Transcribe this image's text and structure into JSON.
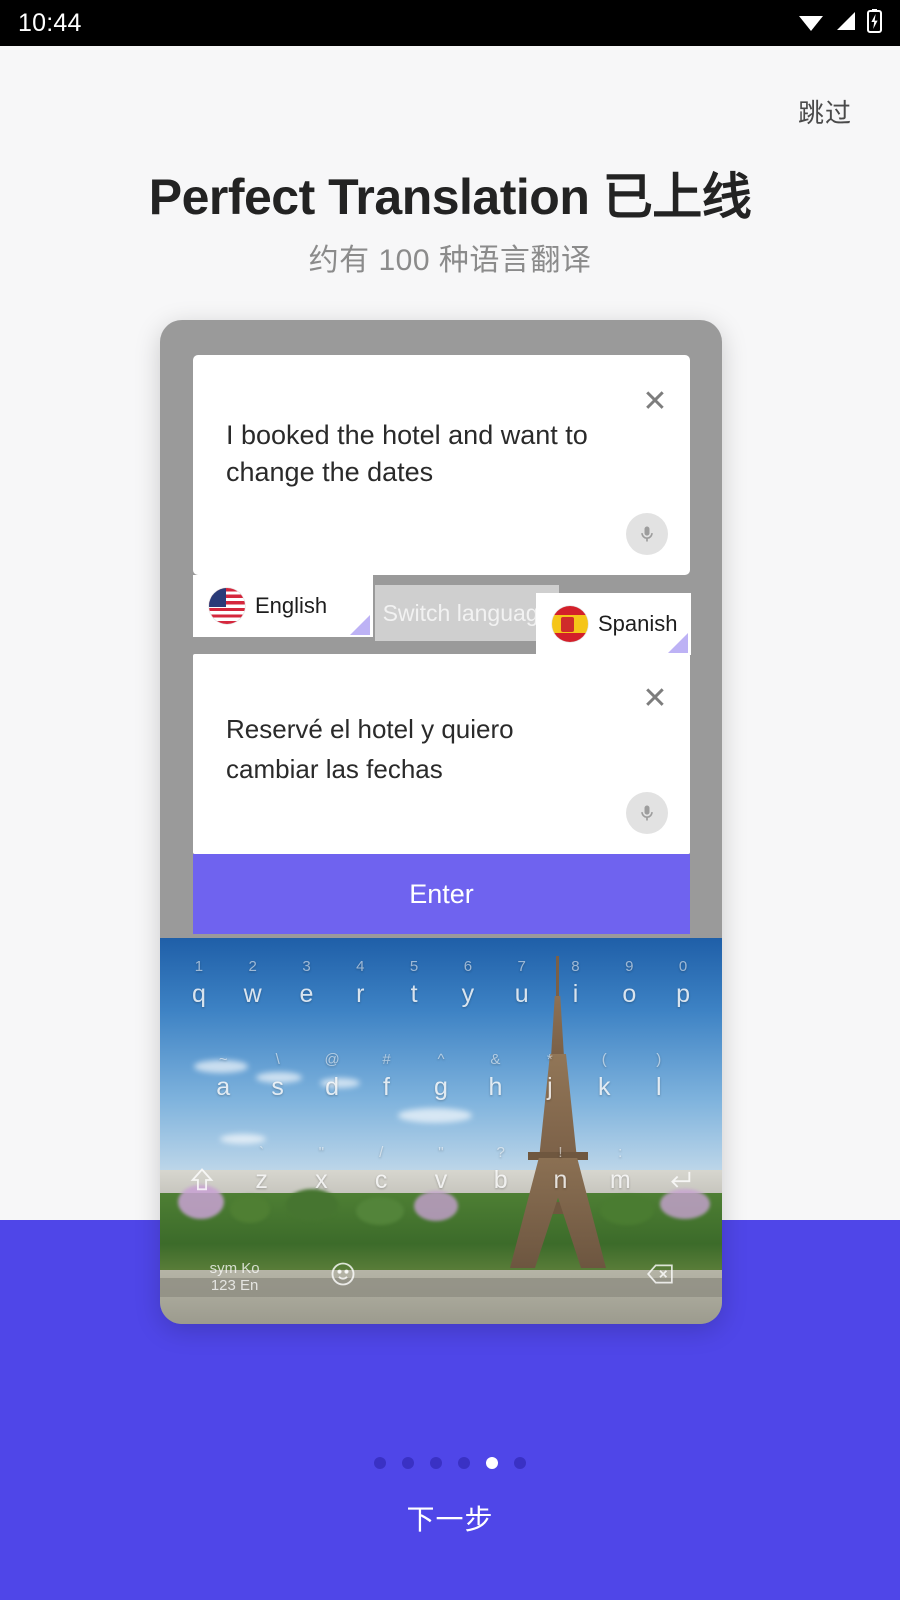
{
  "status_bar": {
    "time": "10:44",
    "icons": [
      "wifi-icon",
      "cellular-signal-icon",
      "battery-charging-icon"
    ]
  },
  "onboarding": {
    "skip_label": "跳过",
    "title": "Perfect Translation 已上线",
    "subtitle": "约有 100 种语言翻译",
    "next_label": "下一步",
    "page_dots": {
      "total": 6,
      "active_index": 4
    }
  },
  "phone_preview": {
    "source_panel": {
      "text": "I booked the hotel and want to change the dates",
      "close_icon": "close-icon",
      "mic_icon": "microphone-icon"
    },
    "language_bar": {
      "source_language": "English",
      "source_flag": "flag-united-states",
      "switch_label": "Switch language",
      "target_language": "Spanish",
      "target_flag": "flag-spain"
    },
    "target_panel": {
      "text": "Reservé el hotel y quiero cambiar las fechas",
      "close_icon": "close-icon",
      "mic_icon": "microphone-icon"
    },
    "enter_label": "Enter",
    "keyboard": {
      "row1_numbers": [
        "1",
        "2",
        "3",
        "4",
        "5",
        "6",
        "7",
        "8",
        "9",
        "0"
      ],
      "row1": [
        "q",
        "w",
        "e",
        "r",
        "t",
        "y",
        "u",
        "i",
        "o",
        "p"
      ],
      "row2": [
        "a",
        "s",
        "d",
        "f",
        "g",
        "h",
        "j",
        "k",
        "l"
      ],
      "row2_sup": [
        "~",
        "\\",
        "@",
        "#",
        "^",
        "&",
        "*",
        "(",
        ")"
      ],
      "row3_shift": "shift-icon",
      "row3": [
        "z",
        "x",
        "c",
        "v",
        "b",
        "n",
        "m"
      ],
      "row3_sup": [
        "`",
        "\"",
        "/",
        "\"",
        "?",
        "!",
        ":"
      ],
      "row3_enter": "enter-key-icon",
      "row4_sym_top": "sym Ko",
      "row4_sym_bottom": "123 En",
      "row4_emoji": "emoji-icon",
      "row4_space": "space-bar",
      "row4_backspace": "backspace-icon",
      "background_image": "eiffel-tower-paris-photo"
    }
  },
  "colors": {
    "panel_purple": "#4F46E8",
    "enter_purple": "#6F63EF",
    "phone_frame_gray": "#9A9A9A",
    "page_background": "#F7F7F8",
    "dot_inactive": "#3A31C4",
    "dot_active": "#FFFFFF",
    "corner_triangle": "#BDB2F5",
    "switch_button_gray": "#CFCFCF"
  }
}
